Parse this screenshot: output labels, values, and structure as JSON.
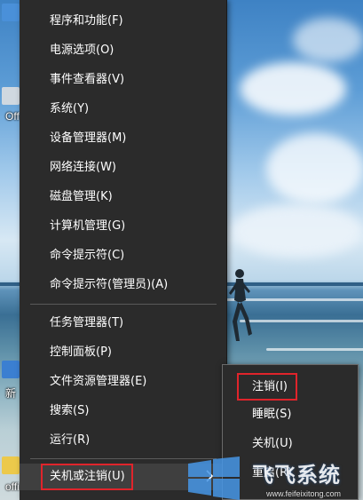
{
  "desktop": {
    "icon_labels": [
      "Off",
      "新",
      "offi"
    ]
  },
  "menu": {
    "items": [
      {
        "label": "程序和功能(F)"
      },
      {
        "label": "电源选项(O)"
      },
      {
        "label": "事件查看器(V)"
      },
      {
        "label": "系统(Y)"
      },
      {
        "label": "设备管理器(M)"
      },
      {
        "label": "网络连接(W)"
      },
      {
        "label": "磁盘管理(K)"
      },
      {
        "label": "计算机管理(G)"
      },
      {
        "label": "命令提示符(C)"
      },
      {
        "label": "命令提示符(管理员)(A)"
      },
      {
        "label": "任务管理器(T)"
      },
      {
        "label": "控制面板(P)"
      },
      {
        "label": "文件资源管理器(E)"
      },
      {
        "label": "搜索(S)"
      },
      {
        "label": "运行(R)"
      },
      {
        "label": "关机或注销(U)"
      }
    ]
  },
  "submenu": {
    "items": [
      {
        "label": "注销(I)"
      },
      {
        "label": "睡眠(S)"
      },
      {
        "label": "关机(U)"
      },
      {
        "label": "重启(R)"
      }
    ]
  },
  "watermark": {
    "brand": "飞飞系统",
    "url": "www.feifeixitong.com"
  },
  "colors": {
    "menu_bg": "#2b2b2b",
    "highlight_border": "#e0242b",
    "separator": "#5a5a5a",
    "text": "#ffffff"
  }
}
